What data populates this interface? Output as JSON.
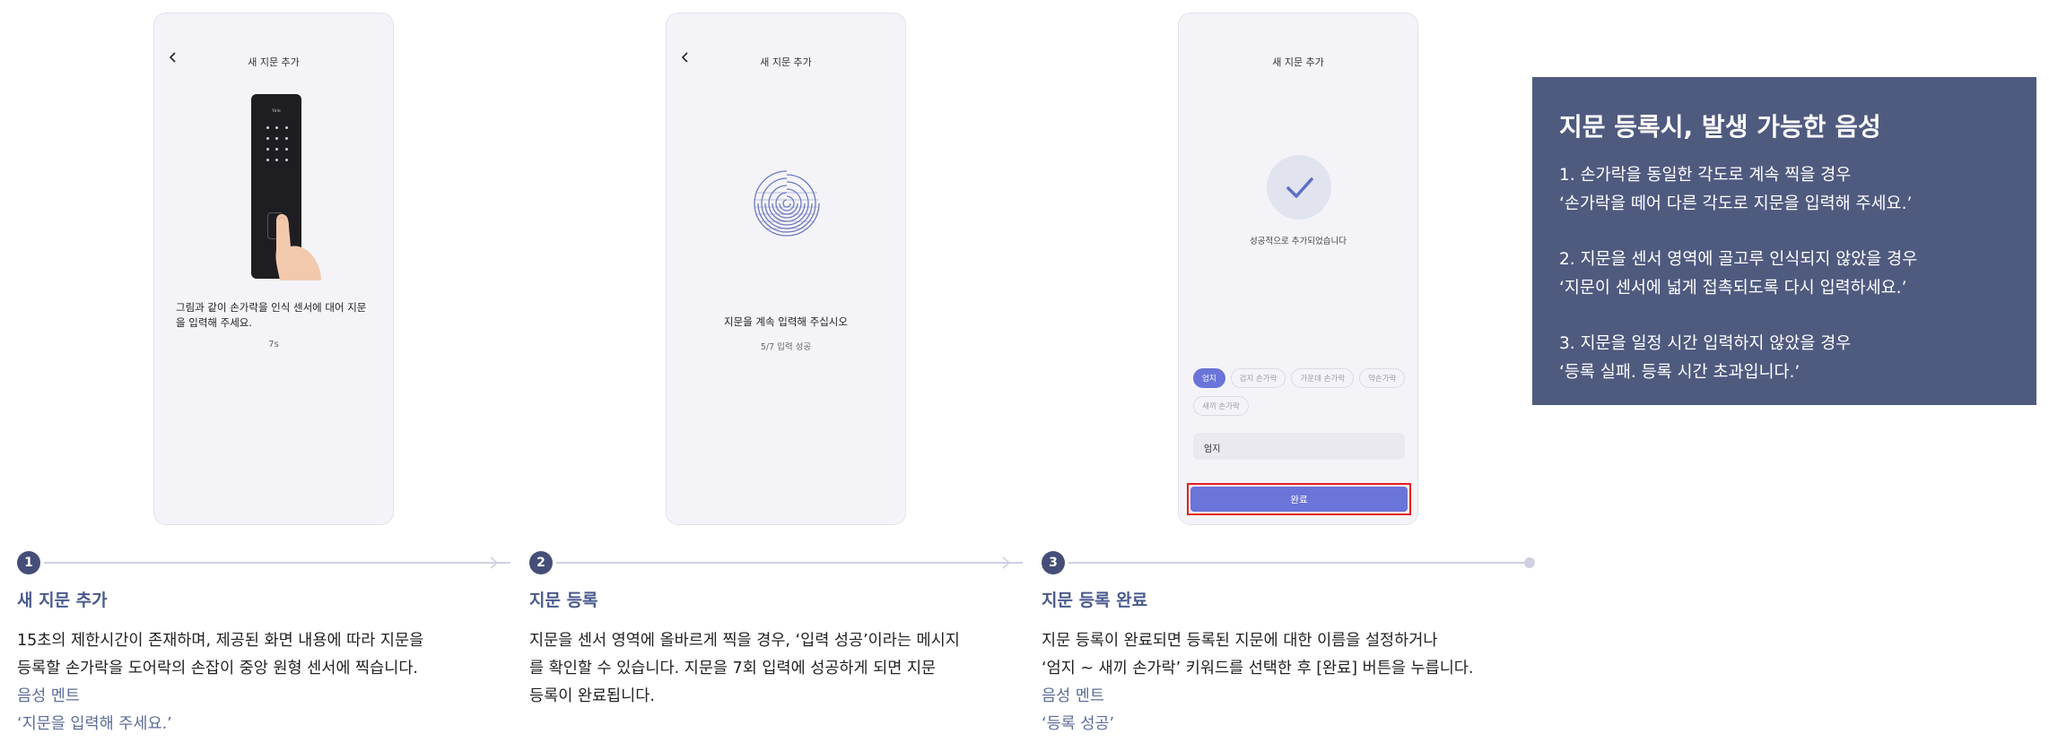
{
  "phone1": {
    "title": "새 지문 추가",
    "lock_brand": "Yale",
    "instruction": "그림과 같이 손가락을 인식 센서에 대어 지문을 입력해 주세요.",
    "timer": "7s"
  },
  "phone2": {
    "title": "새 지문 추가",
    "instruction": "지문을 계속 입력해 주십시오",
    "progress": "5/7 입력 성공",
    "progress_value": 0.714
  },
  "phone3": {
    "title": "새 지문 추가",
    "success": "성공적으로 추가되었습니다",
    "chips": [
      "엄지",
      "검지 손가락",
      "가운데 손가락",
      "약손가락",
      "새끼 손가락"
    ],
    "selected_chip": "엄지",
    "name_value": "엄지",
    "done_label": "완료"
  },
  "steps": [
    {
      "num": "1",
      "title": "새 지문 추가",
      "desc_lines": [
        "15초의 제한시간이 존재하며, 제공된 화면 내용에 따라 지문을",
        "등록할 손가락을 도어락의 손잡이 중앙 원형 센서에 찍습니다."
      ],
      "voice_label": "음성 멘트",
      "voice_text": "‘지문을 입력해 주세요.’"
    },
    {
      "num": "2",
      "title": "지문 등록",
      "desc_lines": [
        "지문을 센서 영역에 올바르게 찍을 경우, ‘입력 성공’이라는 메시지",
        "를 확인할 수 있습니다. 지문을 7회 입력에 성공하게 되면 지문",
        "등록이 완료됩니다."
      ]
    },
    {
      "num": "3",
      "title": "지문 등록 완료",
      "desc_lines": [
        "지문 등록이 완료되면 등록된 지문에 대한 이름을 설정하거나",
        "‘엄지 ~ 새끼 손가락’ 키워드를 선택한 후 [완료] 버튼을 누릅니다."
      ],
      "voice_label": "음성 멘트",
      "voice_text": "‘등록 성공’"
    }
  ],
  "info": {
    "title": "지문 등록시, 발생 가능한 음성",
    "items": [
      {
        "line1": "1. 손가락을 동일한 각도로 계속 찍을 경우",
        "line2": "‘손가락을 떼어 다른 각도로 지문을 입력해 주세요.’"
      },
      {
        "line1": "2. 지문을 센서 영역에 골고루 인식되지 않았을 경우",
        "line2": "‘지문이 센서에 넓게 접촉되도록 다시 입력하세요.’"
      },
      {
        "line1": "3. 지문을 일정 시간 입력하지 않았을 경우",
        "line2": "‘등록 실패. 등록 시간 초과입니다.’"
      }
    ]
  },
  "colors": {
    "accent": "#6b74d8",
    "step_badge": "#454e78",
    "heading": "#4a5a8c",
    "panel_bg": "#4f5a7f",
    "highlight_border": "#e52020"
  }
}
